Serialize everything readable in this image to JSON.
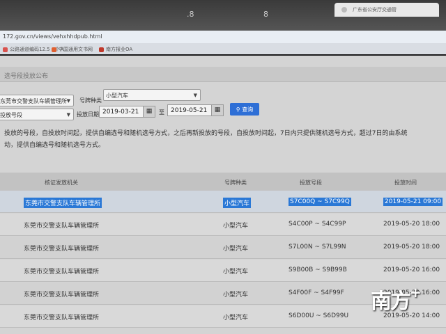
{
  "browser": {
    "tab_marker_left": ".8",
    "tab_marker_right": "8",
    "tab_title": "广东省公安厅交通管",
    "address": "172.gov.cn/views/vehxhhdpub.html",
    "bookmarks": [
      "公路通道编码12.5 - 个人",
      "中国通用文书网",
      "南方报业OA"
    ]
  },
  "panel": {
    "title": "选号段投放公布"
  },
  "filters": {
    "agency_value": "东莞市交警支队车辆管理所",
    "plate_type_label": "号牌种类",
    "plate_type_value": "小型汽车",
    "segment_value": "投放号段",
    "date_label": "投放日期",
    "date_from": "2019-03-21",
    "date_sep": "至",
    "date_to": "2019-05-21",
    "query_label": "查询"
  },
  "notice": {
    "line1": "投放的号段，自投放时间起，提供自编选号和随机选号方式，之后再新投放的号段，自投放时间起，7日内只提供随机选号方式，超过7日的由系统",
    "line2": "动，提供自编选号和随机选号方式。"
  },
  "table": {
    "headers": [
      "核证发放机关",
      "号牌种类",
      "投放号段",
      "投放时间"
    ],
    "rows": [
      {
        "agency": "东莞市交警支队车辆管理所",
        "type": "小型汽车",
        "segment": "S7C00Q ~ S7C99Q",
        "time": "2019-05-21 09:00"
      },
      {
        "agency": "东莞市交警支队车辆管理所",
        "type": "小型汽车",
        "segment": "S4C00P ~ S4C99P",
        "time": "2019-05-20 18:00"
      },
      {
        "agency": "东莞市交警支队车辆管理所",
        "type": "小型汽车",
        "segment": "S7L00N ~ S7L99N",
        "time": "2019-05-20 18:00"
      },
      {
        "agency": "东莞市交警支队车辆管理所",
        "type": "小型汽车",
        "segment": "S9B00B ~ S9B99B",
        "time": "2019-05-20 16:00"
      },
      {
        "agency": "东莞市交警支队车辆管理所",
        "type": "小型汽车",
        "segment": "S4F00F ~ S4F99F",
        "time": "2019-05-20 16:00"
      },
      {
        "agency": "东莞市交警支队车辆管理所",
        "type": "小型汽车",
        "segment": "S6D00U ~ S6D99U",
        "time": "2019-05-20 14:00"
      }
    ]
  },
  "watermark": {
    "text": "南方",
    "plus": "+"
  },
  "colors": {
    "accent": "#2e6fd6",
    "selection": "#2a78d6"
  }
}
